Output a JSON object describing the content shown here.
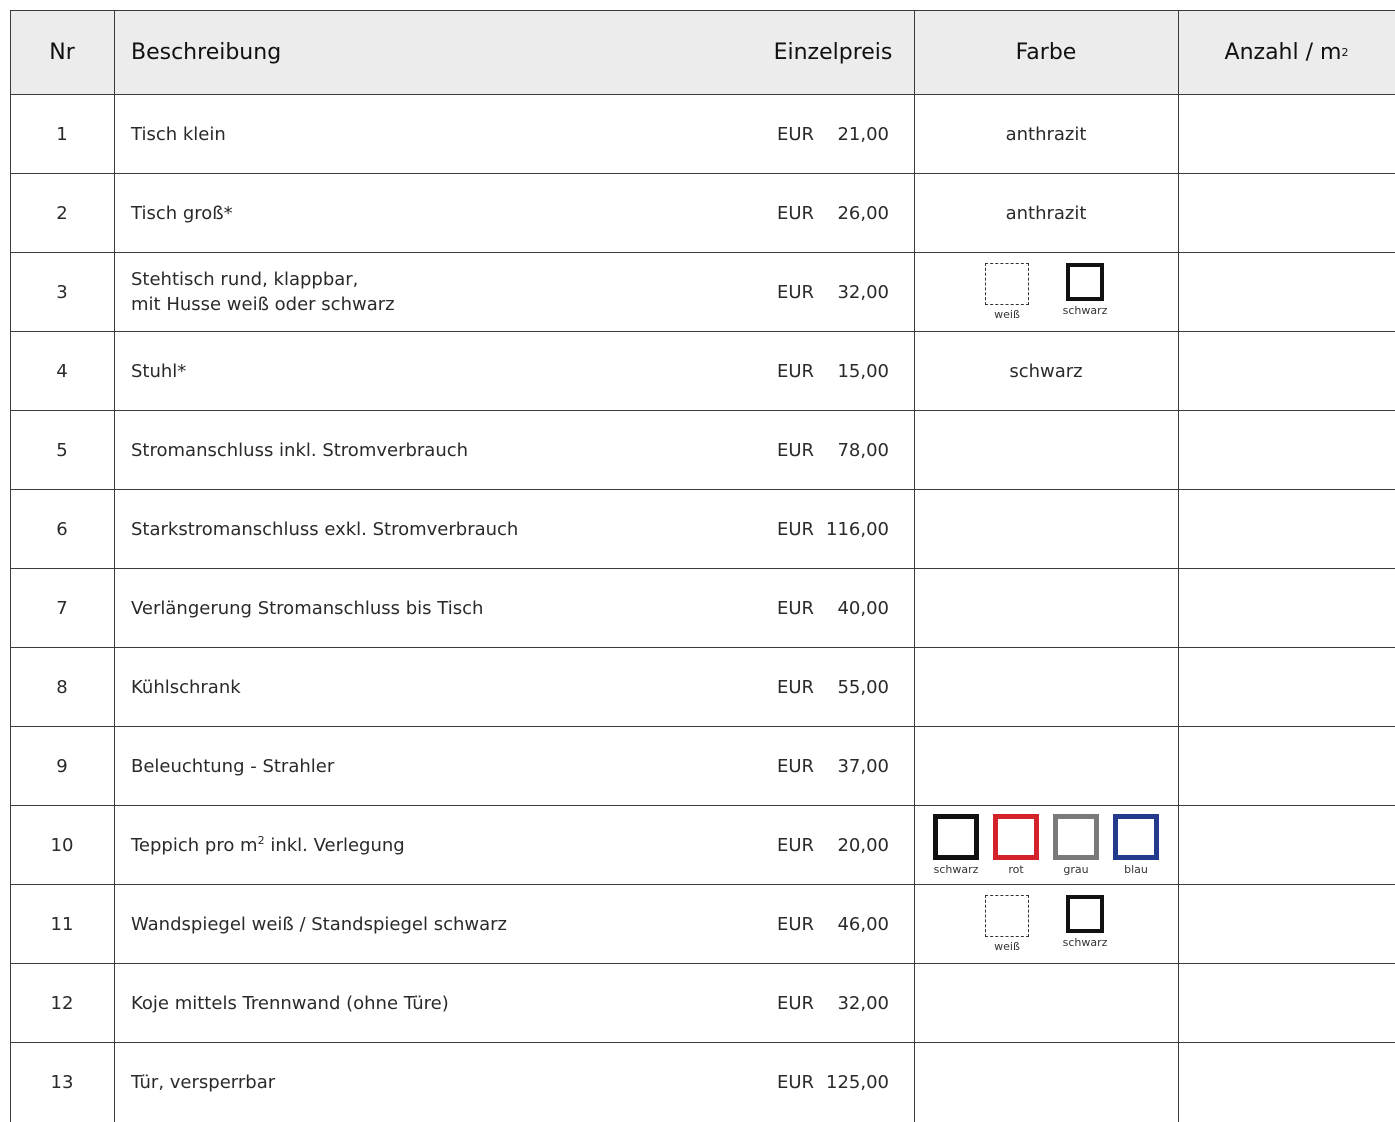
{
  "header": {
    "nr": "Nr",
    "beschreibung": "Beschreibung",
    "einzelpreis": "Einzelpreis",
    "farbe": "Farbe",
    "anzahl": "Anzahl / m",
    "anzahl_sup": "2"
  },
  "rows": [
    {
      "nr": "1",
      "desc": "Tisch klein",
      "cur": "EUR",
      "price": "21,00",
      "farbe": "anthrazit"
    },
    {
      "nr": "2",
      "desc": "Tisch groß*",
      "cur": "EUR",
      "price": "26,00",
      "farbe": "anthrazit"
    },
    {
      "nr": "3",
      "desc_line1": "Stehtisch rund, klappbar,",
      "desc_line2": "mit Husse weiß oder schwarz",
      "cur": "EUR",
      "price": "32,00",
      "swatches": [
        {
          "label": "weiß",
          "color": "#ffffff"
        },
        {
          "label": "schwarz",
          "color": "#111111"
        }
      ]
    },
    {
      "nr": "4",
      "desc": "Stuhl*",
      "cur": "EUR",
      "price": "15,00",
      "farbe": "schwarz"
    },
    {
      "nr": "5",
      "desc": "Stromanschluss inkl. Stromverbrauch",
      "cur": "EUR",
      "price": "78,00"
    },
    {
      "nr": "6",
      "desc": "Starkstromanschluss exkl. Stromverbrauch",
      "cur": "EUR",
      "price": "116,00"
    },
    {
      "nr": "7",
      "desc": "Verlängerung Stromanschluss bis Tisch",
      "cur": "EUR",
      "price": "40,00"
    },
    {
      "nr": "8",
      "desc": "Kühlschrank",
      "cur": "EUR",
      "price": "55,00"
    },
    {
      "nr": "9",
      "desc": "Beleuchtung - Strahler",
      "cur": "EUR",
      "price": "37,00"
    },
    {
      "nr": "10",
      "desc_pre": "Teppich pro m",
      "desc_sup": "2",
      "desc_post": " inkl. Verlegung",
      "cur": "EUR",
      "price": "20,00",
      "swatches": [
        {
          "label": "schwarz",
          "color": "#111111"
        },
        {
          "label": "rot",
          "color": "#d3222a"
        },
        {
          "label": "grau",
          "color": "#7a7a7a"
        },
        {
          "label": "blau",
          "color": "#243a8c"
        }
      ]
    },
    {
      "nr": "11",
      "desc": "Wandspiegel weiß / Standspiegel schwarz",
      "cur": "EUR",
      "price": "46,00",
      "swatches": [
        {
          "label": "weiß",
          "color": "#ffffff"
        },
        {
          "label": "schwarz",
          "color": "#111111"
        }
      ]
    },
    {
      "nr": "12",
      "desc": "Koje mittels Trennwand (ohne Türe)",
      "cur": "EUR",
      "price": "32,00"
    },
    {
      "nr": "13",
      "desc": "Tür, versperrbar",
      "cur": "EUR",
      "price": "125,00"
    }
  ]
}
